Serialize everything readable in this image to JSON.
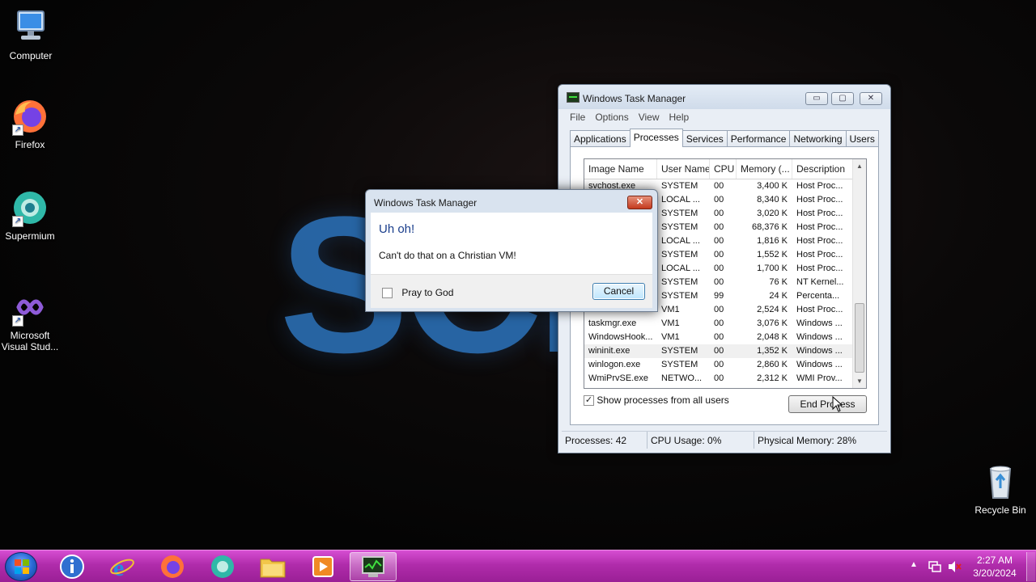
{
  "desktop": {
    "wallpaper_text": "SCr",
    "icons": [
      {
        "label": "Computer",
        "icon": "computer-icon"
      },
      {
        "label": "Firefox",
        "icon": "firefox-icon"
      },
      {
        "label": "Supermium",
        "icon": "supermium-icon"
      },
      {
        "label": "Microsoft Visual Stud...",
        "icon": "visual-studio-icon"
      },
      {
        "label": "Recycle Bin",
        "icon": "recycle-bin-icon"
      }
    ]
  },
  "task_manager": {
    "title": "Windows Task Manager",
    "controls": {
      "minimize": "▭",
      "maximize": "▢",
      "close": "✕"
    },
    "menu": [
      "File",
      "Options",
      "View",
      "Help"
    ],
    "tabs": [
      "Applications",
      "Processes",
      "Services",
      "Performance",
      "Networking",
      "Users"
    ],
    "active_tab": "Processes",
    "columns": [
      "Image Name",
      "User Name",
      "CPU",
      "Memory (...",
      "Description"
    ],
    "rows": [
      [
        "svchost.exe",
        "SYSTEM",
        "00",
        "3,400 K",
        "Host Proc..."
      ],
      [
        "",
        "LOCAL ...",
        "00",
        "8,340 K",
        "Host Proc..."
      ],
      [
        "",
        "SYSTEM",
        "00",
        "3,020 K",
        "Host Proc..."
      ],
      [
        "",
        "SYSTEM",
        "00",
        "68,376 K",
        "Host Proc..."
      ],
      [
        "",
        "LOCAL ...",
        "00",
        "1,816 K",
        "Host Proc..."
      ],
      [
        "",
        "SYSTEM",
        "00",
        "1,552 K",
        "Host Proc..."
      ],
      [
        "",
        "LOCAL ...",
        "00",
        "1,700 K",
        "Host Proc..."
      ],
      [
        "",
        "SYSTEM",
        "00",
        "76 K",
        "NT Kernel..."
      ],
      [
        "",
        "SYSTEM",
        "99",
        "24 K",
        "Percenta..."
      ],
      [
        "",
        "VM1",
        "00",
        "2,524 K",
        "Host Proc..."
      ],
      [
        "taskmgr.exe",
        "VM1",
        "00",
        "3,076 K",
        "Windows ..."
      ],
      [
        "WindowsHook...",
        "VM1",
        "00",
        "2,048 K",
        "Windows ..."
      ],
      [
        "wininit.exe",
        "SYSTEM",
        "00",
        "1,352 K",
        "Windows ..."
      ],
      [
        "winlogon.exe",
        "SYSTEM",
        "00",
        "2,860 K",
        "Windows ..."
      ],
      [
        "WmiPrvSE.exe",
        "NETWO...",
        "00",
        "2,312 K",
        "WMI Prov..."
      ]
    ],
    "selected_row": 12,
    "show_all_label": "Show processes from all users",
    "show_all_checked": "✓",
    "end_process_label": "End Process",
    "status": {
      "processes": "Processes: 42",
      "cpu": "CPU Usage: 0%",
      "memory": "Physical Memory: 28%"
    }
  },
  "dialog": {
    "title": "Windows Task Manager",
    "heading": "Uh oh!",
    "message": "Can't do that on a Christian VM!",
    "checkbox_label": "Pray to God",
    "cancel_label": "Cancel",
    "close_glyph": "✕"
  },
  "taskbar": {
    "pinned": [
      "start-orb",
      "info-icon",
      "internet-explorer-icon",
      "firefox-icon",
      "supermium-icon",
      "file-explorer-icon",
      "media-player-icon",
      "task-manager-icon"
    ],
    "clock_time": "2:27 AM",
    "clock_date": "3/20/2024",
    "tray_icons": [
      "show-hidden-icons",
      "network-icon",
      "volume-muted-icon"
    ]
  },
  "colors": {
    "taskbar": "#b02cab",
    "wallpaper_logo": "#2a6cb0",
    "dialog_heading": "#1a3e8c"
  }
}
